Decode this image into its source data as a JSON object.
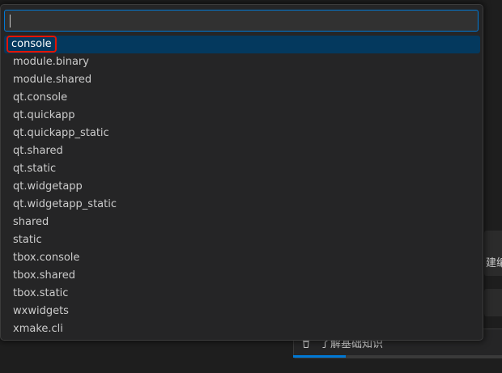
{
  "quickpick": {
    "input_value": "",
    "input_placeholder": "",
    "items": [
      {
        "label": "console"
      },
      {
        "label": "module.binary"
      },
      {
        "label": "module.shared"
      },
      {
        "label": "qt.console"
      },
      {
        "label": "qt.quickapp"
      },
      {
        "label": "qt.quickapp_static"
      },
      {
        "label": "qt.shared"
      },
      {
        "label": "qt.static"
      },
      {
        "label": "qt.widgetapp"
      },
      {
        "label": "qt.widgetapp_static"
      },
      {
        "label": "shared"
      },
      {
        "label": "static"
      },
      {
        "label": "tbox.console"
      },
      {
        "label": "tbox.shared"
      },
      {
        "label": "tbox.static"
      },
      {
        "label": "wxwidgets"
      },
      {
        "label": "xmake.cli"
      }
    ],
    "selected_index": 0
  },
  "background": {
    "peek_text": "建编",
    "card_text": "了解基础知识",
    "card_icon": "trash-icon",
    "progress": 0.24
  },
  "colors": {
    "accent": "#0078d4",
    "selection": "#04395e",
    "highlight_box": "#e51400"
  }
}
